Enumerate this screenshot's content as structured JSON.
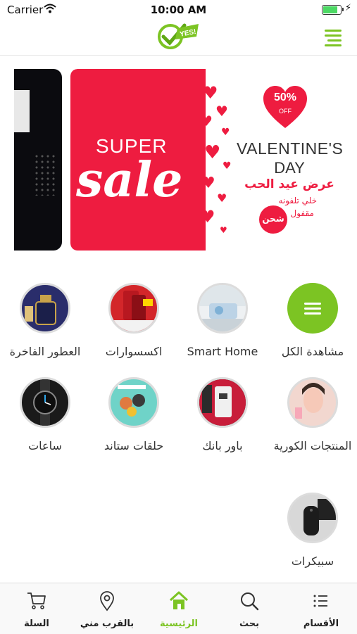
{
  "status_bar": {
    "carrier": "Carrier",
    "time": "10:00 AM",
    "battery_percent": 90
  },
  "header": {
    "logo_text": "YES!"
  },
  "banner": {
    "super": "SUPER",
    "sale": "sale",
    "discount": "50%",
    "discount_sub": "OFF",
    "title_line1": "VALENTINE'S",
    "title_line2": "DAY",
    "offer_ar": "عرض عيد الحب",
    "tagline_ar_1": "خلي تلفونه",
    "tagline_ar_2": "مقفول",
    "ship_ar": "شحن",
    "pages": 4,
    "active_page": 4
  },
  "categories": [
    {
      "label": "مشاهدة الكل",
      "icon": "menu-icon"
    },
    {
      "label": "Smart Home",
      "icon": "smart-home-image"
    },
    {
      "label": "اكسسوارات",
      "icon": "accessories-image"
    },
    {
      "label": "العطور الفاخرة",
      "icon": "perfume-image"
    },
    {
      "label": "المنتجات الكورية",
      "icon": "korean-products-image"
    },
    {
      "label": "باور بانك",
      "icon": "power-bank-image"
    },
    {
      "label": "حلقات ستاند",
      "icon": "ring-stand-image"
    },
    {
      "label": "ساعات",
      "icon": "watch-image"
    },
    {
      "label": "سبيكرات",
      "icon": "speaker-image"
    }
  ],
  "tab_bar": {
    "items": [
      {
        "label": "الأقسام",
        "icon": "list-icon"
      },
      {
        "label": "بحث",
        "icon": "search-icon"
      },
      {
        "label": "الرئيسية",
        "icon": "home-icon"
      },
      {
        "label": "بالقرب مني",
        "icon": "location-pin-icon"
      },
      {
        "label": "السلة",
        "icon": "cart-icon"
      }
    ],
    "active_index": 2
  },
  "colors": {
    "accent": "#7cc423",
    "banner_red": "#ee1c40"
  }
}
